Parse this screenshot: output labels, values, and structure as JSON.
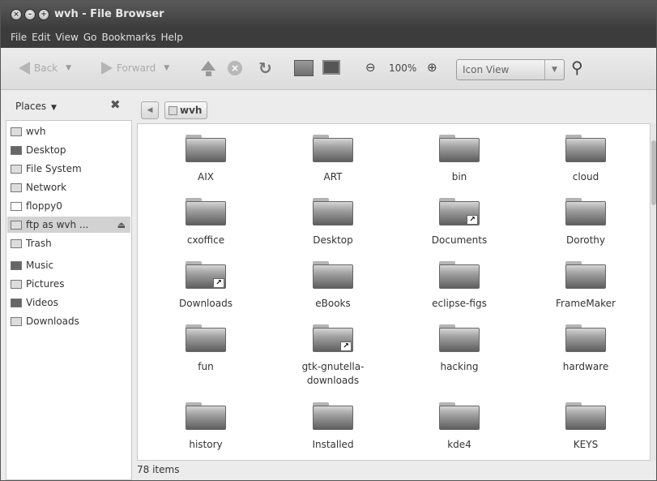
{
  "window": {
    "title": "wvh - File Browser"
  },
  "menu": [
    "File",
    "Edit",
    "View",
    "Go",
    "Bookmarks",
    "Help"
  ],
  "toolbar": {
    "back_label": "Back",
    "forward_label": "Forward",
    "zoom_level": "100%",
    "view_mode": "Icon View"
  },
  "sidebar": {
    "heading": "Places",
    "items": [
      {
        "label": "wvh",
        "icon": "home-folder-icon"
      },
      {
        "label": "Desktop",
        "icon": "desktop-icon"
      },
      {
        "label": "File System",
        "icon": "drive-icon"
      },
      {
        "label": "Network",
        "icon": "network-icon"
      },
      {
        "label": "floppy0",
        "icon": "floppy-icon"
      },
      {
        "label": "ftp as wvh ...",
        "icon": "ftp-icon"
      },
      {
        "label": "Trash",
        "icon": "trash-icon"
      },
      {
        "label": "Music",
        "icon": "music-icon"
      },
      {
        "label": "Pictures",
        "icon": "pictures-icon"
      },
      {
        "label": "Videos",
        "icon": "videos-icon"
      },
      {
        "label": "Downloads",
        "icon": "downloads-icon"
      }
    ]
  },
  "pathbar": {
    "current": "wvh"
  },
  "files": [
    {
      "name": "AIX",
      "link": false
    },
    {
      "name": "ART",
      "link": false
    },
    {
      "name": "bin",
      "link": false
    },
    {
      "name": "cloud",
      "link": false
    },
    {
      "name": "cxoffice",
      "link": false
    },
    {
      "name": "Desktop",
      "link": false
    },
    {
      "name": "Documents",
      "link": true
    },
    {
      "name": "Dorothy",
      "link": false
    },
    {
      "name": "Downloads",
      "link": true
    },
    {
      "name": "eBooks",
      "link": false
    },
    {
      "name": "eclipse-figs",
      "link": false
    },
    {
      "name": "FrameMaker",
      "link": false
    },
    {
      "name": "fun",
      "link": false
    },
    {
      "name": "gtk-gnutella-downloads",
      "line1": "gtk-gnutella-",
      "line2": "downloads",
      "link": true
    },
    {
      "name": "hacking",
      "link": false
    },
    {
      "name": "hardware",
      "link": false
    },
    {
      "name": "history",
      "link": false
    },
    {
      "name": "Installed",
      "link": false
    },
    {
      "name": "kde4",
      "link": false
    },
    {
      "name": "KEYS",
      "link": false
    }
  ],
  "status": {
    "text": "78 items"
  }
}
